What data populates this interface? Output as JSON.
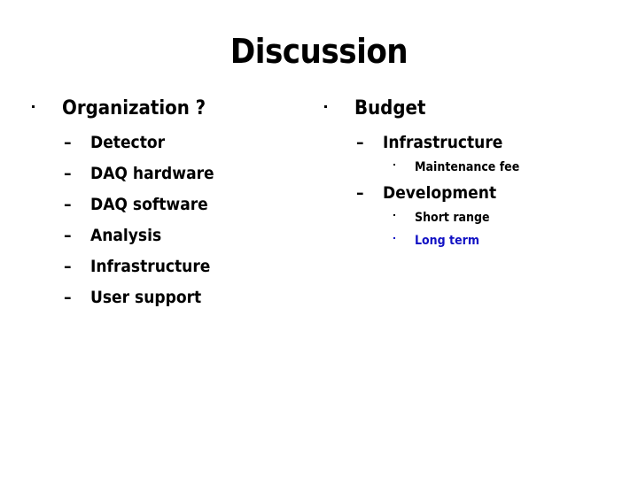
{
  "slide": {
    "title": "Discussion",
    "background_color": "#ffffff",
    "text_color": "#000000",
    "accent_color": "#1111c4"
  },
  "columns": {
    "left": {
      "heading": {
        "label": "Organization ?",
        "bullet": "square-dot"
      },
      "items": [
        {
          "label": "Detector",
          "bullet": "en-dash"
        },
        {
          "label": "DAQ hardware",
          "bullet": "en-dash"
        },
        {
          "label": "DAQ software",
          "bullet": "en-dash"
        },
        {
          "label": "Analysis",
          "bullet": "en-dash"
        },
        {
          "label": "Infrastructure",
          "bullet": "en-dash"
        },
        {
          "label": "User support",
          "bullet": "en-dash"
        }
      ]
    },
    "right": {
      "heading": {
        "label": "Budget",
        "bullet": "square-dot"
      },
      "items": [
        {
          "label": "Infrastructure",
          "bullet": "en-dash",
          "children": [
            {
              "label": "Maintenance fee",
              "bullet": "small-dot",
              "color": "#000000"
            }
          ]
        },
        {
          "label": "Development",
          "bullet": "en-dash",
          "children": [
            {
              "label": "Short range",
              "bullet": "small-dot",
              "color": "#000000"
            },
            {
              "label": "Long term",
              "bullet": "small-dot",
              "color": "#1111c4"
            }
          ]
        }
      ]
    }
  },
  "bullets": {
    "en_dash": "–"
  }
}
